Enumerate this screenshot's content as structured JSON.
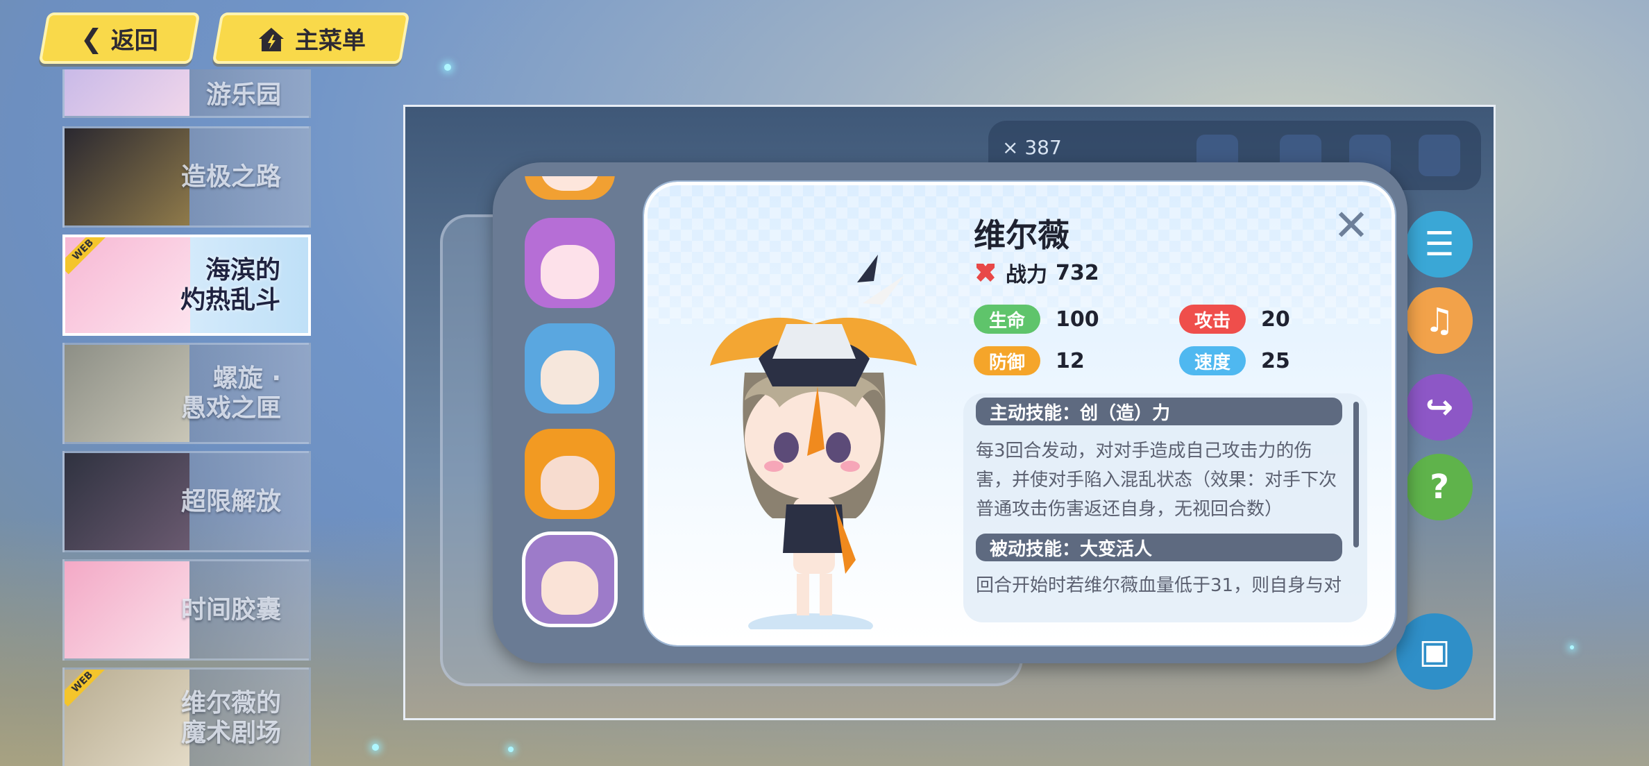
{
  "nav": {
    "back_label": "返回",
    "menu_label": "主菜单"
  },
  "sidebar": {
    "items": [
      {
        "label": "游乐园"
      },
      {
        "label": "造极之路"
      },
      {
        "label": "海滨的\n灼热乱斗",
        "web_tag": "WEB"
      },
      {
        "label": "螺旋 ·\n愚戏之匣"
      },
      {
        "label": "超限解放"
      },
      {
        "label": "时间胶囊"
      },
      {
        "label": "维尔薇的\n魔术剧场",
        "web_tag": "WEB"
      }
    ]
  },
  "game_hud": {
    "coin_text": "× 387"
  },
  "character": {
    "name": "维尔薇",
    "power_label": "战力",
    "power_value": "732",
    "stats": {
      "hp": {
        "label": "生命",
        "value": "100"
      },
      "atk": {
        "label": "攻击",
        "value": "20"
      },
      "def": {
        "label": "防御",
        "value": "12"
      },
      "spd": {
        "label": "速度",
        "value": "25"
      }
    },
    "skills": {
      "active_title": "主动技能：创（造）力",
      "active_desc_1": "每3回合发动，对对手造成自己攻击力的伤",
      "active_desc_2": "害，并使对手陷入混乱状态（效果：对手下次",
      "active_desc_3": "普通攻击伤害返还自身，无视回合数）",
      "passive_title": "被动技能：大变活人",
      "passive_desc_1": "回合开始时若维尔薇血量低于31，则自身与对"
    }
  },
  "colors": {
    "hp": "#5fc46b",
    "atk": "#ef4e4b",
    "def": "#f5a52a",
    "spd": "#4fb8f0",
    "button_yellow": "#f9d94a",
    "modal": "#6a7b94"
  }
}
